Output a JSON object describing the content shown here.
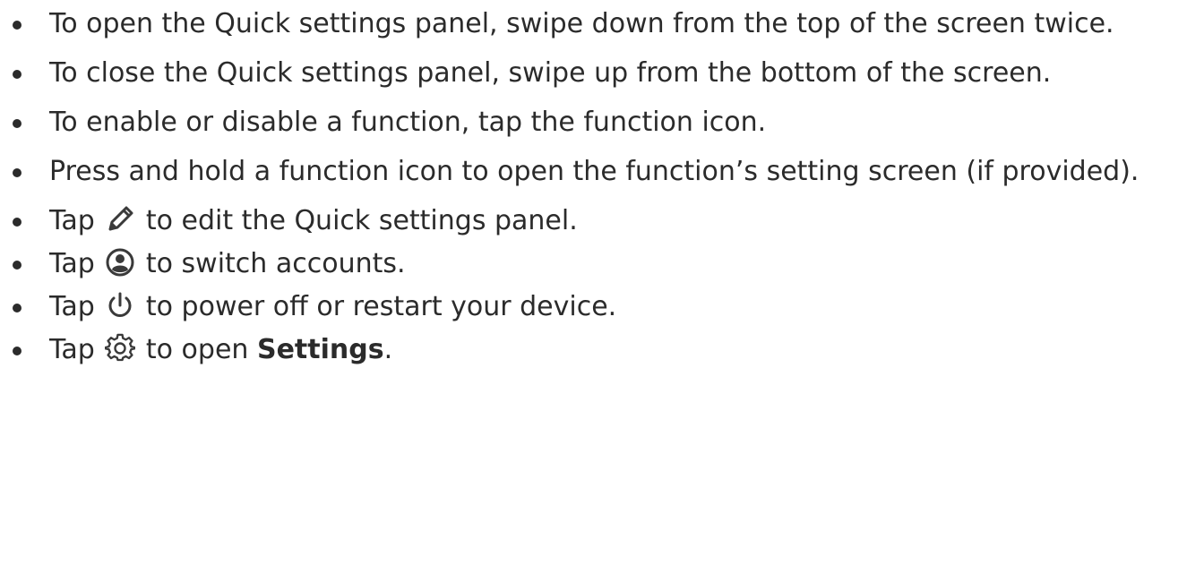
{
  "list": {
    "items": [
      {
        "text": "To open the Quick settings panel, swipe down from the top of the screen twice."
      },
      {
        "text": "To close the Quick settings panel, swipe up from the bottom of the screen."
      },
      {
        "text": "To enable or disable a function, tap the function icon."
      },
      {
        "text": "Press and hold a function icon to open the function’s setting screen (if provided)."
      },
      {
        "prefix": "Tap",
        "icon": "pencil-icon",
        "suffix": "to edit the Quick settings panel."
      },
      {
        "prefix": "Tap",
        "icon": "account-icon",
        "suffix": "to switch accounts."
      },
      {
        "prefix": "Tap",
        "icon": "power-icon",
        "suffix": "to power off or restart your device."
      },
      {
        "prefix": "Tap",
        "icon": "gear-icon",
        "suffix": "to open",
        "bold": "Settings",
        "end": "."
      }
    ]
  },
  "colors": {
    "text": "#2b2b2b",
    "icon": "#3a3a3a"
  }
}
